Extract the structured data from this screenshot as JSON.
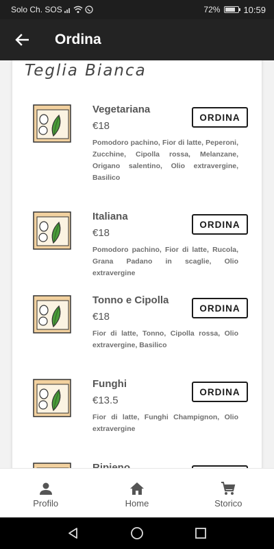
{
  "status_bar": {
    "carrier": "Solo Ch. SOS",
    "battery": "72%",
    "time": "10:59"
  },
  "app_bar": {
    "title": "Ordina",
    "back_icon": "arrow-back-icon"
  },
  "section": {
    "title": "Teglia Bianca"
  },
  "items": [
    {
      "name": "Vegetariana",
      "price": "€18",
      "description": "Pomodoro pachino, Fior di latte, Peperoni, Zucchine, Cipolla rossa, Melanzane, Origano salentino, Olio extravergine, Basilico",
      "button": "ORDINA"
    },
    {
      "name": "Italiana",
      "price": "€18",
      "description": "Pomodoro pachino, Fior di latte, Rucola, Grana Padano in scaglie, Olio extravergine",
      "button": "ORDINA"
    },
    {
      "name": "Tonno e Cipolla",
      "price": "€18",
      "description": "Fior di latte, Tonno, Cipolla rossa, Olio extravergine, Basilico",
      "button": "ORDINA"
    },
    {
      "name": "Funghi",
      "price": "€13.5",
      "description": "Fior di latte, Funghi Champignon, Olio extravergine",
      "button": "ORDINA"
    },
    {
      "name": "Ripieno",
      "price": "",
      "description": "",
      "button": ""
    }
  ],
  "bottom_nav": {
    "items": [
      {
        "label": "Profilo",
        "icon": "person-icon"
      },
      {
        "label": "Home",
        "icon": "home-icon"
      },
      {
        "label": "Storico",
        "icon": "cart-icon"
      }
    ]
  },
  "colors": {
    "app_bar": "#232323",
    "status_bar": "#1e1e1e",
    "pizza_crust": "#f2d19f",
    "basil": "#4a9a3a"
  }
}
